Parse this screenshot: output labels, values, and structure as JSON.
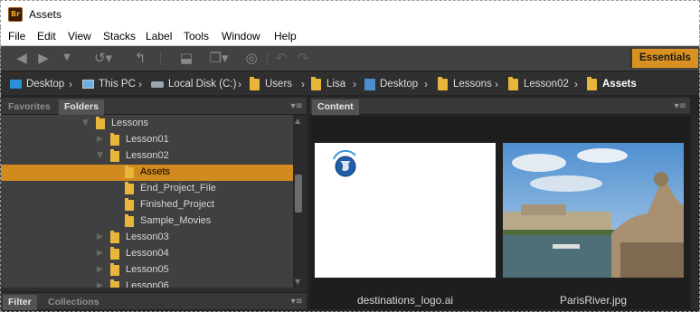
{
  "window": {
    "title": "Assets",
    "app_icon_text": "Br"
  },
  "menu": [
    "File",
    "Edit",
    "View",
    "Stacks",
    "Label",
    "Tools",
    "Window",
    "Help"
  ],
  "toolbar": {
    "workspace_label": "Essentials",
    "icons": [
      "back-arrow-icon",
      "forward-arrow-icon",
      "dropdown-icon",
      "recent-icon",
      "boomerang-icon",
      "camera-import-icon",
      "refine-icon",
      "rotate-icon",
      "rotate-ccw-icon",
      "rotate-cw-icon"
    ]
  },
  "path": [
    {
      "label": "Desktop",
      "icon": "desktop-icon"
    },
    {
      "label": "This PC",
      "icon": "pc-icon"
    },
    {
      "label": "Local Disk (C:)",
      "icon": "disk-icon"
    },
    {
      "label": "Users",
      "icon": "folder-icon"
    },
    {
      "label": "Lisa",
      "icon": "folder-icon"
    },
    {
      "label": "Desktop",
      "icon": "desktop-folder-icon"
    },
    {
      "label": "Lessons",
      "icon": "folder-icon"
    },
    {
      "label": "Lesson02",
      "icon": "folder-icon"
    },
    {
      "label": "Assets",
      "icon": "folder-icon"
    }
  ],
  "left_panel": {
    "tabs": [
      "Favorites",
      "Folders"
    ],
    "active_tab": "Folders",
    "tree": [
      {
        "label": "Lessons",
        "expanded": true
      },
      {
        "label": "Lesson01",
        "expanded": false
      },
      {
        "label": "Lesson02",
        "expanded": true
      },
      {
        "label": "Assets",
        "selected": true
      },
      {
        "label": "End_Project_File"
      },
      {
        "label": "Finished_Project"
      },
      {
        "label": "Sample_Movies"
      },
      {
        "label": "Lesson03",
        "expanded": false
      },
      {
        "label": "Lesson04",
        "expanded": false
      },
      {
        "label": "Lesson05",
        "expanded": false
      },
      {
        "label": "Lesson06",
        "expanded": false
      }
    ],
    "bottom_tabs": [
      "Filter",
      "Collections"
    ]
  },
  "content_panel": {
    "tab": "Content",
    "items": [
      {
        "filename": "destinations_logo.ai"
      },
      {
        "filename": "ParisRiver.jpg"
      }
    ]
  },
  "colors": {
    "accent": "#d08a1e",
    "workspace": "#d9911f"
  }
}
